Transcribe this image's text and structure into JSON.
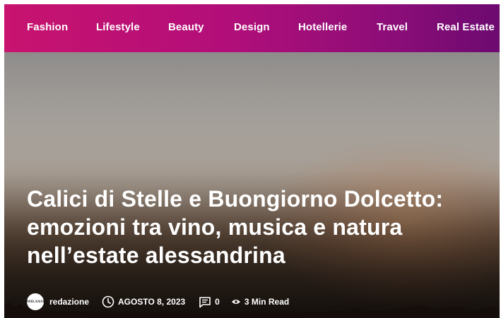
{
  "nav": {
    "items": [
      {
        "label": "Fashion"
      },
      {
        "label": "Lifestyle"
      },
      {
        "label": "Beauty"
      },
      {
        "label": "Design"
      },
      {
        "label": "Hotellerie"
      },
      {
        "label": "Travel"
      },
      {
        "label": "Real Estate"
      }
    ],
    "gradient_colors": [
      "#c8136f",
      "#6c0a70"
    ]
  },
  "article": {
    "title": "Calici di Stelle e Buongiorno Dolcetto: emozioni tra vino, musica e natura nell’estate alessandrina",
    "author": "redazione",
    "avatar_text": "MILANO",
    "date": "AGOSTO 8, 2023",
    "comments": "0",
    "read_time": "3 Min Read"
  },
  "icons": {
    "date": "clock-icon",
    "comments": "comment-icon",
    "read_time": "eye-icon"
  }
}
